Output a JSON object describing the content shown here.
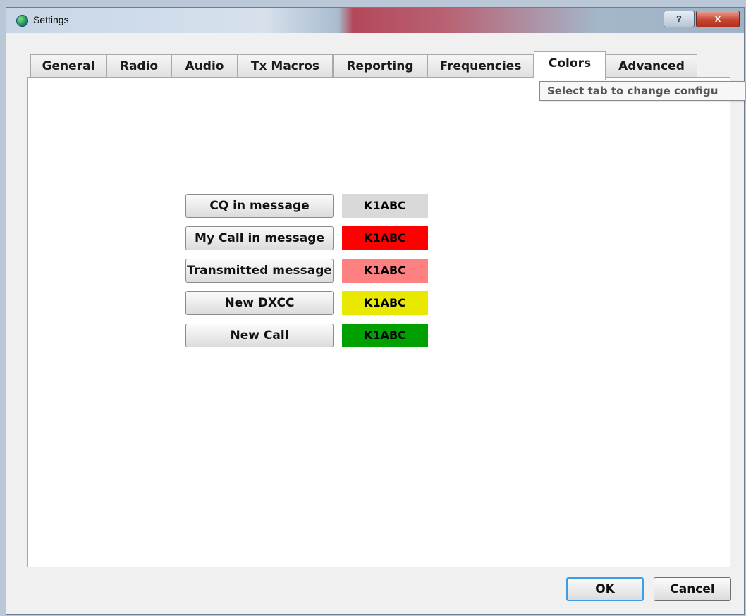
{
  "window": {
    "title": "Settings"
  },
  "title_buttons": {
    "help": "?",
    "close": "x"
  },
  "tabs": [
    {
      "label": "General",
      "active": false
    },
    {
      "label": "Radio",
      "active": false
    },
    {
      "label": "Audio",
      "active": false
    },
    {
      "label": "Tx Macros",
      "active": false
    },
    {
      "label": "Reporting",
      "active": false
    },
    {
      "label": "Frequencies",
      "active": false
    },
    {
      "label": "Colors",
      "active": true
    },
    {
      "label": "Advanced",
      "active": false
    }
  ],
  "tooltip": "Select tab to change configu",
  "colors": {
    "rows": [
      {
        "button": "CQ in message",
        "sample": "K1ABC",
        "color": "#d9d9d9"
      },
      {
        "button": "My Call in message",
        "sample": "K1ABC",
        "color": "#ff0000"
      },
      {
        "button": "Transmitted message",
        "sample": "K1ABC",
        "color": "#ff8080"
      },
      {
        "button": "New DXCC",
        "sample": "K1ABC",
        "color": "#e8e800"
      },
      {
        "button": "New Call",
        "sample": "K1ABC",
        "color": "#00a000"
      }
    ]
  },
  "footer": {
    "ok": "OK",
    "cancel": "Cancel"
  }
}
